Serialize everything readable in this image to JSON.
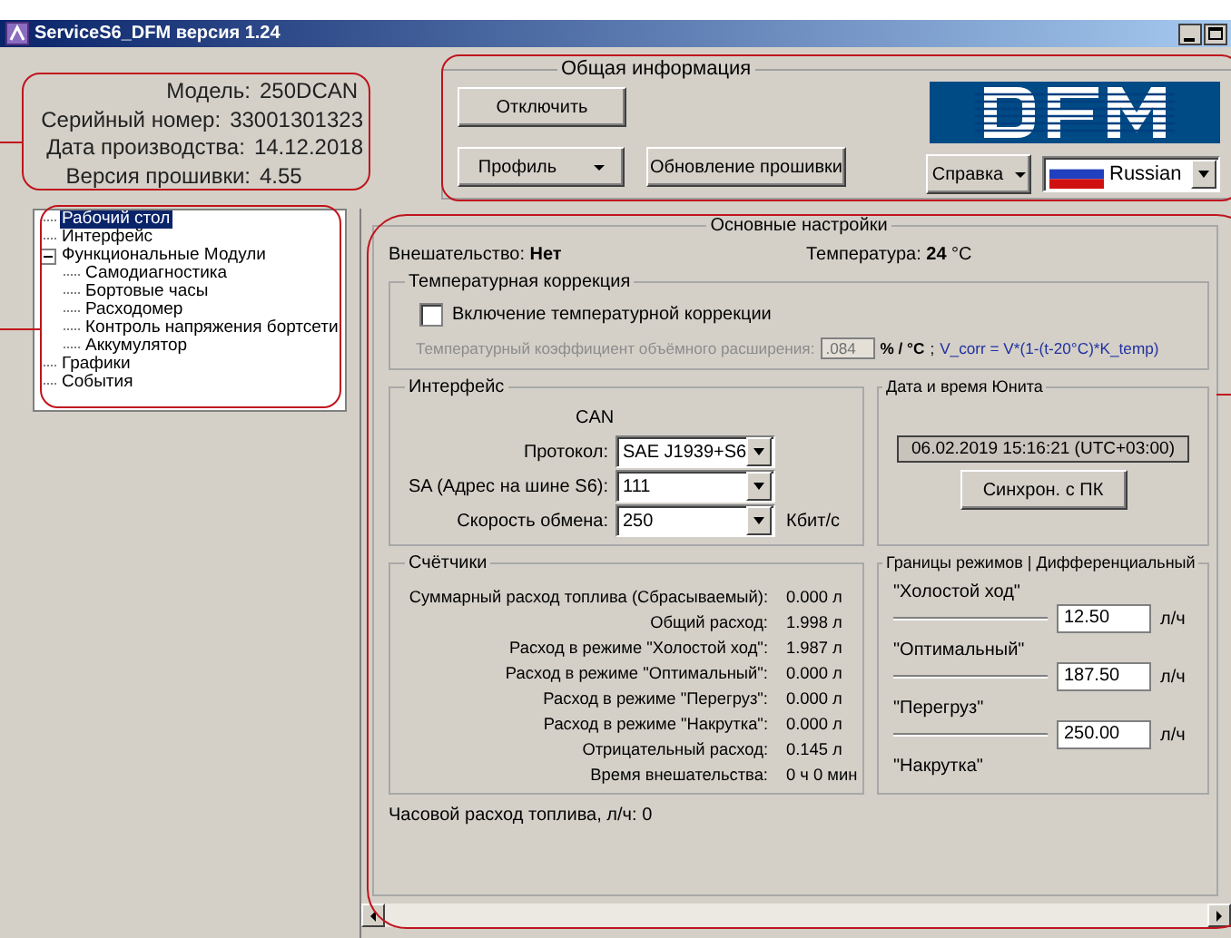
{
  "window": {
    "title": "ServiceS6_DFM версия 1.24"
  },
  "device_info": [
    {
      "label": "Модель:",
      "value": "250DCAN"
    },
    {
      "label": "Серийный номер:",
      "value": "33001301323"
    },
    {
      "label": "Дата производства:",
      "value": "14.12.2018"
    },
    {
      "label": "Версия прошивки:",
      "value": "4.55"
    }
  ],
  "general_info": {
    "title": "Общая информация",
    "buttons": [
      {
        "label": "Отключить",
        "dropdown": false
      },
      {
        "label": "Профиль",
        "dropdown": true
      },
      {
        "label": "Обновление прошивки",
        "dropdown": false
      }
    ],
    "help": {
      "label": "Справка",
      "dropdown": true
    },
    "language": {
      "value": "Russian"
    }
  },
  "tree": [
    {
      "label": "Рабочий стол",
      "selected": true
    },
    {
      "label": "Интерфейс",
      "selected": false
    },
    {
      "label": "Функциональные Модули",
      "selected": false,
      "expanded": true,
      "children": [
        {
          "label": "Самодиагностика",
          "selected": false
        },
        {
          "label": "Бортовые часы",
          "selected": false
        },
        {
          "label": "Расходомер",
          "selected": false
        },
        {
          "label": "Контроль напряжения бортсети",
          "selected": false
        },
        {
          "label": "Аккумулятор",
          "selected": false
        }
      ]
    },
    {
      "label": "Графики",
      "selected": false
    },
    {
      "label": "События",
      "selected": false
    }
  ],
  "main": {
    "title": "Основные настройки",
    "interference": {
      "label": "Внешательство:",
      "value": "Нет"
    },
    "temperature": {
      "label": "Температура:",
      "value": "24",
      "unit": "°C"
    },
    "temp_correction": {
      "title": "Температурная коррекция",
      "checkbox": {
        "label": "Включение температурной коррекции",
        "checked": false
      },
      "coefficient": {
        "label": "Температурный коэффициент объёмного расширения:",
        "value": ".084",
        "unit": "% / °C",
        "disabled": true
      },
      "separator": ";",
      "formula": "V_corr = V*(1-(t-20°C)*K_temp)"
    },
    "interface": {
      "title": "Интерфейс",
      "bus": "CAN",
      "fields": [
        {
          "label": "Протокол:",
          "value": "SAE J1939+S6"
        },
        {
          "label": "SA (Адрес на шине S6):",
          "value": "111"
        },
        {
          "label": "Скорость обмена:",
          "value": "250",
          "unit": "Кбит/с"
        }
      ]
    },
    "unit_datetime": {
      "title": "Дата и время Юнита",
      "value": "06.02.2019 15:16:21 (UTC+03:00)",
      "button": "Синхрон. с ПК"
    },
    "counters": {
      "title": "Счётчики",
      "rows": [
        {
          "label": "Суммарный расход топлива (Сбрасываемый):",
          "value": "0.000 л"
        },
        {
          "label": "Общий расход:",
          "value": "1.998 л"
        },
        {
          "label": "Расход в режиме \"Холостой ход\":",
          "value": "1.987 л"
        },
        {
          "label": "Расход в режиме \"Оптимальный\":",
          "value": "0.000 л"
        },
        {
          "label": "Расход в режиме \"Перегруз\":",
          "value": "0.000 л"
        },
        {
          "label": "Расход в режиме \"Накрутка\":",
          "value": "0.000 л"
        },
        {
          "label": "Отрицательный расход:",
          "value": "0.145 л"
        },
        {
          "label": "Время внешательства:",
          "value": "0 ч 0 мин"
        }
      ]
    },
    "mode_limits": {
      "title": "Границы режимов | Дифференциальный",
      "modes": [
        {
          "label": "\"Холостой ход\"",
          "value": "12.50",
          "unit": "л/ч"
        },
        {
          "label": "\"Оптимальный\"",
          "value": "187.50",
          "unit": "л/ч"
        },
        {
          "label": "\"Перегруз\"",
          "value": "250.00",
          "unit": "л/ч"
        },
        {
          "label": "\"Накрутка\""
        }
      ]
    },
    "hourly": {
      "label": "Часовой расход топлива, л/ч:",
      "value": "0"
    }
  }
}
